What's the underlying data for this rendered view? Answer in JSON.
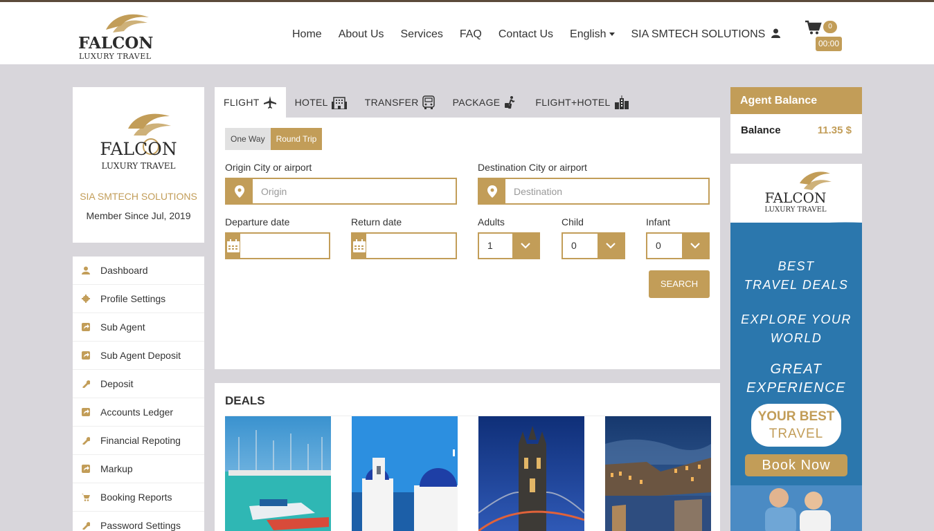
{
  "brand": {
    "name": "FALCON",
    "tagline": "LUXURY TRAVEL",
    "sidebar_tagline": "LUXURY TRAVEL"
  },
  "nav": {
    "items": [
      "Home",
      "About Us",
      "Services",
      "FAQ",
      "Contact Us"
    ],
    "language": "English",
    "account": "SIA SMTECH SOLUTIONS"
  },
  "cart": {
    "count": "0",
    "total": "00:00"
  },
  "profile": {
    "company": "SIA SMTECH SOLUTIONS",
    "member_since": "Member Since Jul, 2019"
  },
  "menu": [
    {
      "label": "Dashboard",
      "icon": "user-icon"
    },
    {
      "label": "Profile Settings",
      "icon": "gear-icon"
    },
    {
      "label": "Sub Agent",
      "icon": "share-icon"
    },
    {
      "label": "Sub Agent Deposit",
      "icon": "share-icon"
    },
    {
      "label": "Deposit",
      "icon": "wrench-icon"
    },
    {
      "label": "Accounts Ledger",
      "icon": "share-icon"
    },
    {
      "label": "Financial Repoting",
      "icon": "wrench-icon"
    },
    {
      "label": "Markup",
      "icon": "share-icon"
    },
    {
      "label": "Booking Reports",
      "icon": "cart-icon"
    },
    {
      "label": "Password Settings",
      "icon": "wrench-icon"
    }
  ],
  "tabs": [
    {
      "label": "FLIGHT",
      "icon": "plane-icon",
      "active": true
    },
    {
      "label": "HOTEL",
      "icon": "building-icon",
      "active": false
    },
    {
      "label": "TRANSFER",
      "icon": "bus-icon",
      "active": false
    },
    {
      "label": "PACKAGE",
      "icon": "traveler-icon",
      "active": false
    },
    {
      "label": "FLIGHT+HOTEL",
      "icon": "city-icon",
      "active": false
    }
  ],
  "search": {
    "one_way": "One Way",
    "round_trip": "Round Trip",
    "origin_label": "Origin City or airport",
    "origin_placeholder": "Origin",
    "destination_label": "Destination City or airport",
    "destination_placeholder": "Destination",
    "departure_label": "Departure date",
    "return_label": "Return date",
    "adults_label": "Adults",
    "adults_value": "1",
    "child_label": "Child",
    "child_value": "0",
    "infant_label": "Infant",
    "infant_value": "0",
    "search_button": "SEARCH"
  },
  "deals": {
    "title": "DEALS"
  },
  "balance": {
    "title": "Agent Balance",
    "label": "Balance",
    "value": "11.35 $"
  },
  "ad": {
    "brand": "FALCON",
    "tagline": "LUXURY TRAVEL",
    "line1": "BEST",
    "line2": "TRAVEL DEALS",
    "line3": "EXPLORE YOUR",
    "line4": "WORLD",
    "line5": "GREAT",
    "line6": "EXPERIENCE",
    "badge1": "YOUR BEST",
    "badge2": "TRAVEL",
    "button": "Book Now"
  },
  "colors": {
    "accent": "#c29d58",
    "background": "#d8d6db",
    "ad_blue": "#2b77ad"
  }
}
